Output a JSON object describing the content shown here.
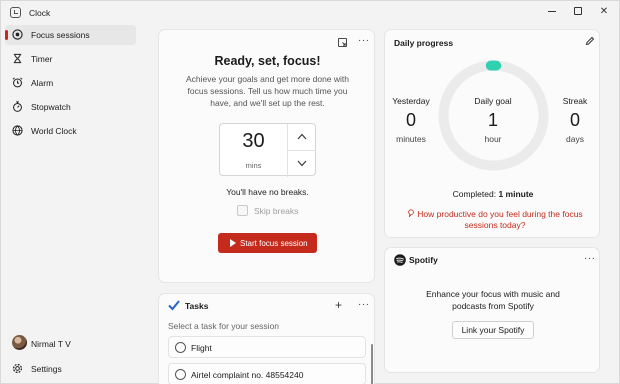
{
  "window": {
    "title": "Clock"
  },
  "sidebar": {
    "items": [
      {
        "label": "Focus sessions",
        "icon": "focus-icon",
        "active": true
      },
      {
        "label": "Timer",
        "icon": "timer-icon"
      },
      {
        "label": "Alarm",
        "icon": "alarm-icon"
      },
      {
        "label": "Stopwatch",
        "icon": "stopwatch-icon"
      },
      {
        "label": "World Clock",
        "icon": "globe-icon"
      }
    ],
    "user": {
      "name": "Nirmal T V"
    },
    "settings_label": "Settings"
  },
  "focus": {
    "title": "Ready, set, focus!",
    "description": "Achieve your goals and get more done with focus sessions. Tell us how much time you have, and we'll set up the rest.",
    "duration_value": "30",
    "duration_unit": "mins",
    "breaks_text": "You'll have no breaks.",
    "skip_breaks_label": "Skip breaks",
    "start_label": "Start focus session"
  },
  "progress": {
    "title": "Daily progress",
    "yesterday": {
      "label": "Yesterday",
      "value": "0",
      "unit": "minutes"
    },
    "goal": {
      "label": "Daily goal",
      "value": "1",
      "unit": "hour"
    },
    "streak": {
      "label": "Streak",
      "value": "0",
      "unit": "days"
    },
    "completed_label": "Completed:",
    "completed_value": "1 minute",
    "feedback_link": "How productive do you feel during the focus sessions today?",
    "ring_fraction": 0.017
  },
  "spotify": {
    "brand": "Spotify",
    "description": "Enhance your focus with music and podcasts from Spotify",
    "link_label": "Link your Spotify"
  },
  "tasks": {
    "title": "Tasks",
    "hint": "Select a task for your session",
    "items": [
      {
        "label": "Flight"
      },
      {
        "label": "Airtel complaint no. 48554240"
      }
    ]
  },
  "colors": {
    "accent": "#c42b1c",
    "ring_progress": "#2fd1b0",
    "ring_track": "#ebebeb"
  }
}
